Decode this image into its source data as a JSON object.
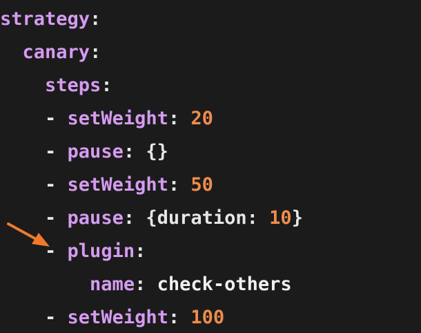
{
  "code": {
    "lines": [
      {
        "indent": "",
        "dash": "",
        "key": "strategy",
        "colon": ":",
        "value": "",
        "value_type": ""
      },
      {
        "indent": "  ",
        "dash": "",
        "key": "canary",
        "colon": ":",
        "value": "",
        "value_type": ""
      },
      {
        "indent": "    ",
        "dash": "",
        "key": "steps",
        "colon": ":",
        "value": "",
        "value_type": ""
      },
      {
        "indent": "    ",
        "dash": "- ",
        "key": "setWeight",
        "colon": ": ",
        "value": "20",
        "value_type": "num"
      },
      {
        "indent": "    ",
        "dash": "- ",
        "key": "pause",
        "colon": ": ",
        "value": "{}",
        "value_type": "punct"
      },
      {
        "indent": "    ",
        "dash": "- ",
        "key": "setWeight",
        "colon": ": ",
        "value": "50",
        "value_type": "num"
      },
      {
        "indent": "    ",
        "dash": "- ",
        "key": "pause",
        "colon": ": ",
        "value": "{duration: 10}",
        "value_type": "mixed"
      },
      {
        "indent": "    ",
        "dash": "- ",
        "key": "plugin",
        "colon": ":",
        "value": "",
        "value_type": ""
      },
      {
        "indent": "        ",
        "dash": "",
        "key": "name",
        "colon": ": ",
        "value": "check-others",
        "value_type": "str"
      },
      {
        "indent": "    ",
        "dash": "- ",
        "key": "setWeight",
        "colon": ": ",
        "value": "100",
        "value_type": "num"
      }
    ],
    "duration_parts": {
      "open": "{",
      "key": "duration",
      "colon": ": ",
      "num": "10",
      "close": "}"
    }
  },
  "colors": {
    "background": "#1b1b1b",
    "key": "#d59bf0",
    "number": "#f08c4c",
    "text": "#e6e6e6",
    "arrow": "#f07a2a"
  },
  "annotation": {
    "icon": "arrow-right-icon",
    "points_to_line": 7
  }
}
